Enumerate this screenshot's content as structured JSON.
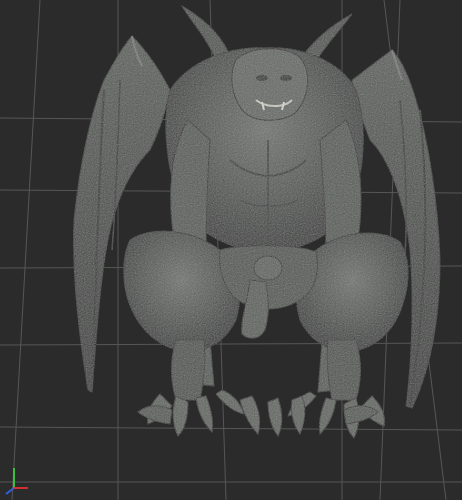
{
  "viewport": {
    "background_color": "#2b2b2b",
    "grid_color": "#6a6a6a",
    "model": {
      "type": "gargoyle-creature",
      "skin_color": "#4d524e",
      "highlight_color": "#7b807a",
      "shadow_color": "#1c1e1c"
    },
    "axis_gizmo": {
      "x_axis_color": "#d23030",
      "y_axis_color": "#3bc03b",
      "z_axis_color": "#3060e0"
    }
  }
}
